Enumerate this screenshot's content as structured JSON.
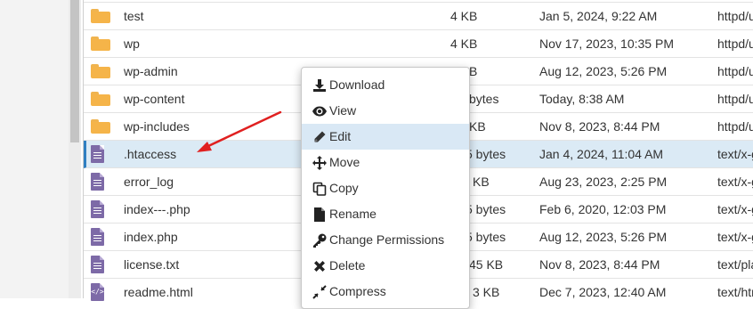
{
  "files": [
    {
      "name": "test",
      "size": "4 KB",
      "modified": "Jan 5, 2024, 9:22 AM",
      "type": "httpd/u",
      "icon": "folder-icon"
    },
    {
      "name": "wp",
      "size": "4 KB",
      "modified": "Nov 17, 2023, 10:35 PM",
      "type": "httpd/u",
      "icon": "folder-icon"
    },
    {
      "name": "wp-admin",
      "size": "B",
      "modified": "Aug 12, 2023, 5:26 PM",
      "type": "httpd/u",
      "icon": "folder-icon"
    },
    {
      "name": "wp-content",
      "size": "bytes",
      "modified": "Today, 8:38 AM",
      "type": "httpd/u",
      "icon": "folder-icon"
    },
    {
      "name": "wp-includes",
      "size": "KB",
      "modified": "Nov 8, 2023, 8:44 PM",
      "type": "httpd/u",
      "icon": "folder-icon"
    },
    {
      "name": ".htaccess",
      "size": "5 bytes",
      "modified": "Jan 4, 2024, 11:04 AM",
      "type": "text/x-g",
      "icon": "file-text-icon"
    },
    {
      "name": "error_log",
      "size": "KB",
      "modified": "Aug 23, 2023, 2:25 PM",
      "type": "text/x-g",
      "icon": "file-text-icon"
    },
    {
      "name": "index---.php",
      "size": "5 bytes",
      "modified": "Feb 6, 2020, 12:03 PM",
      "type": "text/x-g",
      "icon": "file-text-icon"
    },
    {
      "name": "index.php",
      "size": "5 bytes",
      "modified": "Aug 12, 2023, 5:26 PM",
      "type": "text/x-g",
      "icon": "file-text-icon"
    },
    {
      "name": "license.txt",
      "size": "45 KB",
      "modified": "Nov 8, 2023, 8:44 PM",
      "type": "text/pla",
      "icon": "file-text-icon"
    },
    {
      "name": "readme.html",
      "size": "3 KB",
      "modified": "Dec 7, 2023, 12:40 AM",
      "type": "text/htr",
      "icon": "file-code-icon"
    }
  ],
  "context_menu": {
    "items": [
      {
        "label": "Download",
        "icon": "download-icon"
      },
      {
        "label": "View",
        "icon": "eye-icon"
      },
      {
        "label": "Edit",
        "icon": "pencil-icon"
      },
      {
        "label": "Move",
        "icon": "move-arrows-icon"
      },
      {
        "label": "Copy",
        "icon": "copy-icon"
      },
      {
        "label": "Rename",
        "icon": "file-icon"
      },
      {
        "label": "Change Permissions",
        "icon": "key-icon"
      },
      {
        "label": "Delete",
        "icon": "x-icon"
      },
      {
        "label": "Compress",
        "icon": "compress-icon"
      }
    ]
  },
  "colors": {
    "selected_row": "#dbeaf5",
    "menu_hover": "#d9e8f5",
    "folder": "#f5b449",
    "file": "#7d6aa7",
    "arrow": "#e02020"
  }
}
